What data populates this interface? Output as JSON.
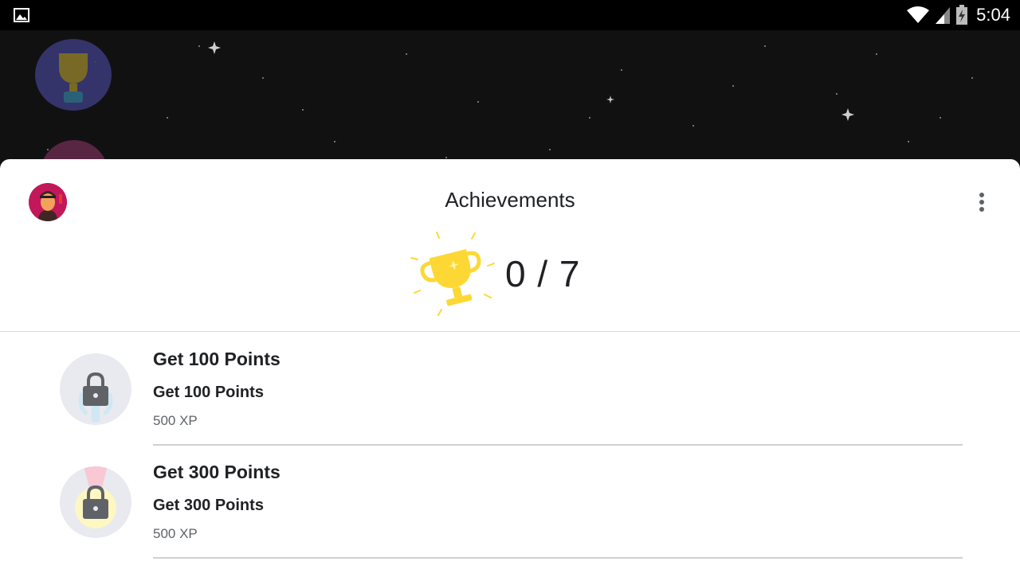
{
  "status_bar": {
    "time": "5:04",
    "icons": [
      "image-icon",
      "wifi-icon",
      "signal-icon",
      "battery-charging-icon"
    ]
  },
  "sheet": {
    "title": "Achievements",
    "progress": "0 / 7",
    "more_icon": "more-vert-icon",
    "accent_color": "#FDD835"
  },
  "achievements": [
    {
      "title": "Get 100 Points",
      "description": "Get 100 Points",
      "xp": "500 XP",
      "locked": true,
      "icon": "lock-icon"
    },
    {
      "title": "Get 300 Points",
      "description": "Get 300 Points",
      "xp": "500 XP",
      "locked": true,
      "icon": "lock-icon"
    }
  ]
}
